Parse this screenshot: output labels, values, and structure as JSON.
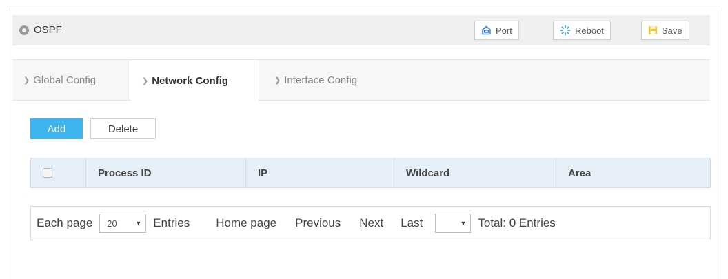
{
  "header": {
    "title": "OSPF",
    "buttons": {
      "port": "Port",
      "reboot": "Reboot",
      "save": "Save"
    }
  },
  "tabs": [
    {
      "label": "Global Config",
      "active": false
    },
    {
      "label": "Network Config",
      "active": true
    },
    {
      "label": "Interface Config",
      "active": false
    }
  ],
  "toolbar": {
    "add_label": "Add",
    "delete_label": "Delete"
  },
  "table": {
    "columns": [
      "Process ID",
      "IP",
      "Wildcard",
      "Area"
    ],
    "rows": []
  },
  "pager": {
    "each_page_label": "Each page",
    "page_size": "20",
    "entries_label": "Entries",
    "home_label": "Home page",
    "prev_label": "Previous",
    "next_label": "Next",
    "last_label": "Last",
    "page_select_value": "",
    "total_label": "Total: 0 Entries"
  },
  "icons": {
    "header": "circle-icon",
    "port": "port-icon",
    "reboot": "reboot-icon",
    "save": "save-icon",
    "tab_chevron": "chevron-right-icon"
  },
  "colors": {
    "primary": "#3fb5ef",
    "header_bg": "#efefef",
    "table_header_bg": "#e6eef7",
    "save_icon": "#f5c73a",
    "port_icon": "#3a7bd5",
    "reboot_icon": "#3aa0e0"
  }
}
